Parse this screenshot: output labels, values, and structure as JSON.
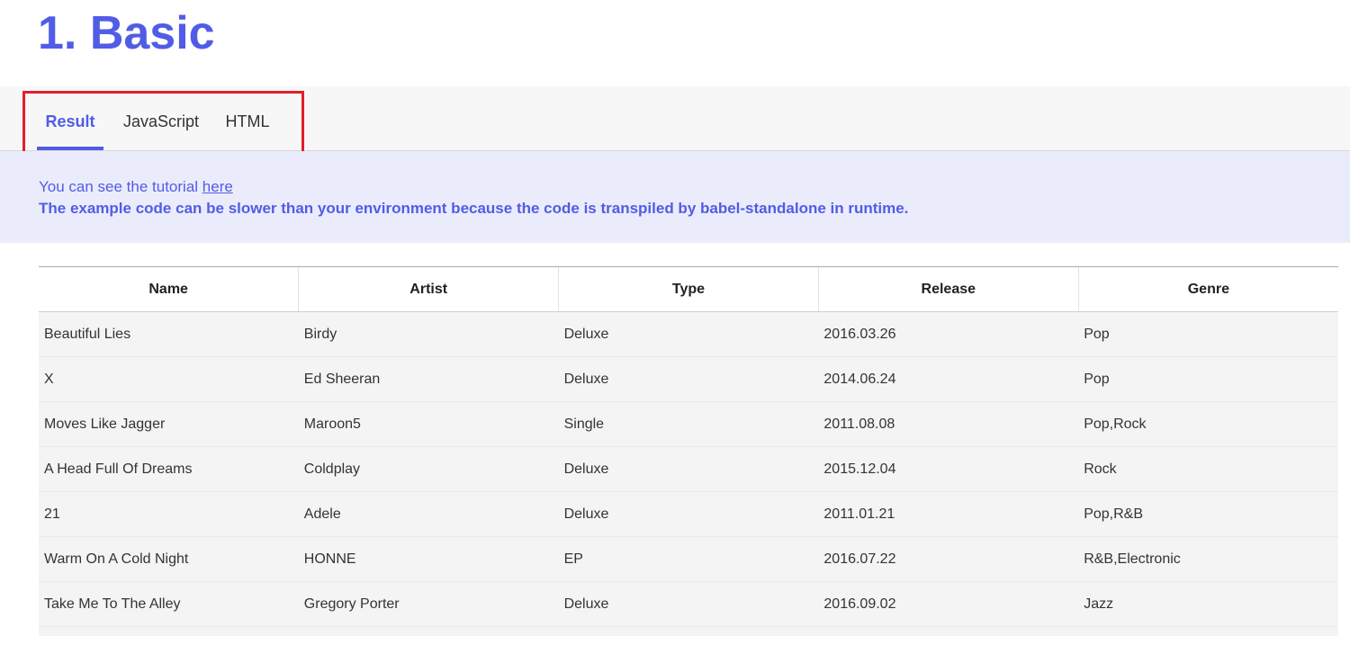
{
  "page": {
    "title": "1. Basic"
  },
  "tabs": [
    {
      "label": "Result",
      "active": true
    },
    {
      "label": "JavaScript",
      "active": false
    },
    {
      "label": "HTML",
      "active": false
    }
  ],
  "notice": {
    "line1_prefix": "You can see the tutorial ",
    "line1_link": "here",
    "line2": "The example code can be slower than your environment because the code is transpiled by babel-standalone in runtime."
  },
  "grid": {
    "columns": [
      "Name",
      "Artist",
      "Type",
      "Release",
      "Genre"
    ],
    "rows": [
      [
        "Beautiful Lies",
        "Birdy",
        "Deluxe",
        "2016.03.26",
        "Pop"
      ],
      [
        "X",
        "Ed Sheeran",
        "Deluxe",
        "2014.06.24",
        "Pop"
      ],
      [
        "Moves Like Jagger",
        "Maroon5",
        "Single",
        "2011.08.08",
        "Pop,Rock"
      ],
      [
        "A Head Full Of Dreams",
        "Coldplay",
        "Deluxe",
        "2015.12.04",
        "Rock"
      ],
      [
        "21",
        "Adele",
        "Deluxe",
        "2011.01.21",
        "Pop,R&B"
      ],
      [
        "Warm On A Cold Night",
        "HONNE",
        "EP",
        "2016.07.22",
        "R&B,Electronic"
      ],
      [
        "Take Me To The Alley",
        "Gregory Porter",
        "Deluxe",
        "2016.09.02",
        "Jazz"
      ]
    ]
  },
  "colors": {
    "accent": "#515ce6",
    "highlight": "#e21e2b",
    "notice_bg": "#ebecfb"
  }
}
